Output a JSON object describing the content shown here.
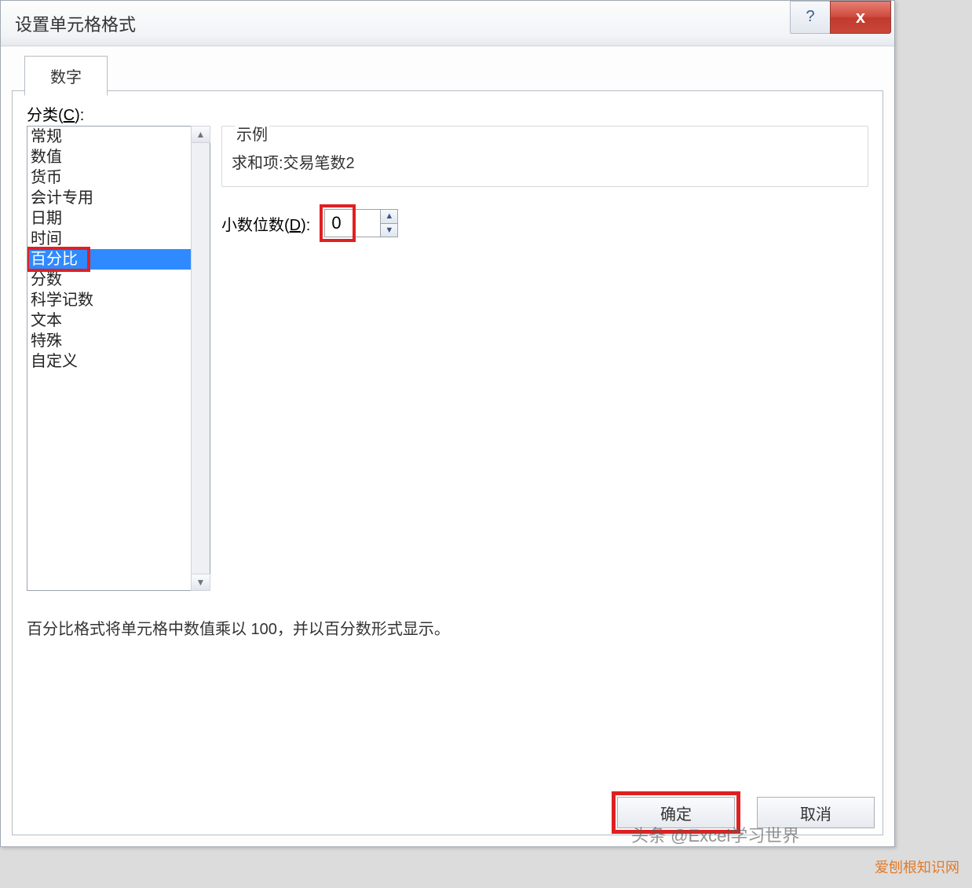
{
  "titlebar": {
    "title": "设置单元格格式",
    "help_label": "?",
    "close_label": "x"
  },
  "tabs": {
    "number_label": "数字"
  },
  "category": {
    "label_prefix": "分类(",
    "label_key": "C",
    "label_suffix": "):",
    "items": [
      "常规",
      "数值",
      "货币",
      "会计专用",
      "日期",
      "时间",
      "百分比",
      "分数",
      "科学记数",
      "文本",
      "特殊",
      "自定义"
    ],
    "selected_index": 6
  },
  "example": {
    "label": "示例",
    "value": "求和项:交易笔数2"
  },
  "decimal": {
    "label_prefix": "小数位数(",
    "label_key": "D",
    "label_suffix": "):",
    "value": "0"
  },
  "description": "百分比格式将单元格中数值乘以 100，并以百分数形式显示。",
  "footer": {
    "ok_label": "确定",
    "cancel_label": "取消"
  },
  "watermarks": {
    "w1": "头条 @Excel学习世界",
    "w2": "爱刨根知识网"
  }
}
